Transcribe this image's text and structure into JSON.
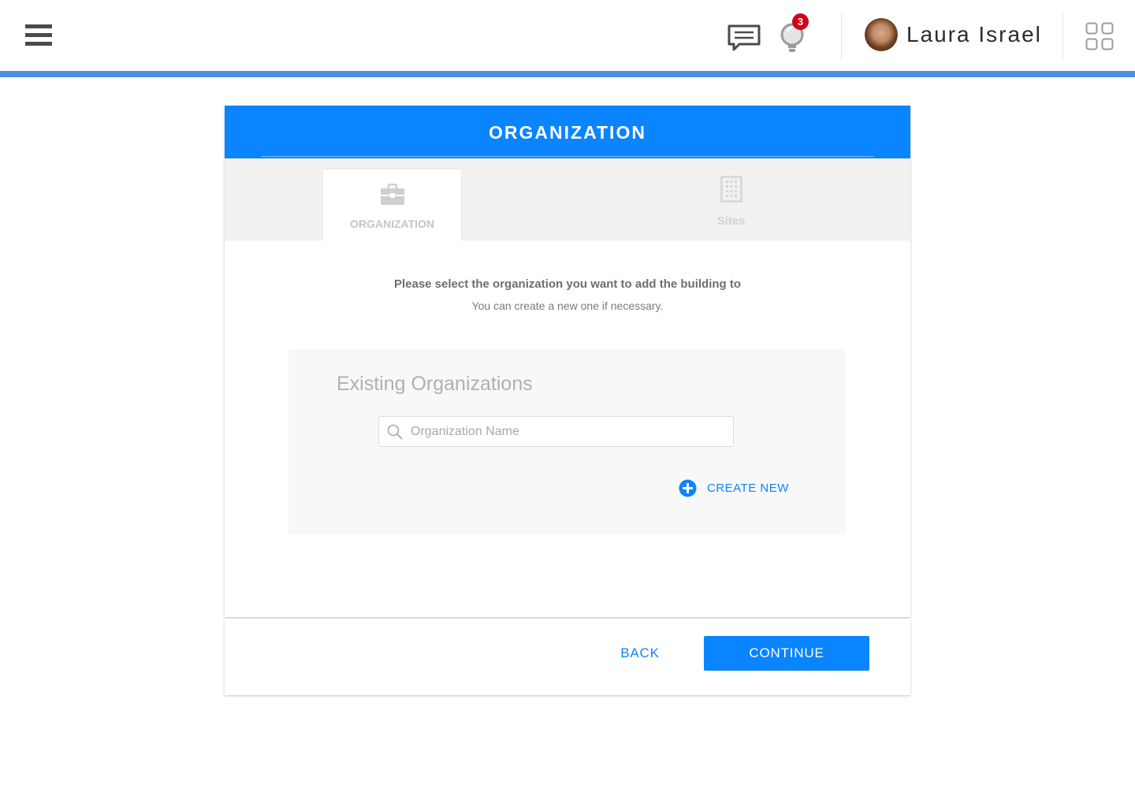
{
  "topbar": {
    "menu_icon": "hamburger-menu-icon",
    "messages_icon": "chat-bubble-icon",
    "notifications_icon": "lightbulb-icon",
    "notification_count": "3",
    "user_name": "Laura Israel",
    "apps_icon": "grid-apps-icon",
    "accent_color": "#4a90e2",
    "badge_color": "#d0021b"
  },
  "card": {
    "title": "ORGANIZATION",
    "header_color": "#0a84ff",
    "tabs": [
      {
        "label": "ORGANIZATION",
        "icon": "briefcase-icon",
        "active": true
      },
      {
        "label": "Sites",
        "icon": "building-icon",
        "active": false
      }
    ],
    "intro_title": "Please select the organization you want to add the building to",
    "intro_subtitle": "You can create a new one if necessary.",
    "panel": {
      "title": "Existing Organizations",
      "search_placeholder": "Organization Name",
      "search_value": "",
      "create_new_label": "CREATE NEW"
    }
  },
  "footer": {
    "back_label": "BACK",
    "continue_label": "CONTINUE"
  }
}
